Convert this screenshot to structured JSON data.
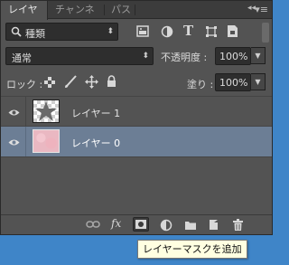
{
  "tabs": [
    {
      "label": "レイヤー",
      "active": true
    },
    {
      "label": "チャンネル",
      "active": false
    },
    {
      "label": "パス",
      "active": false
    }
  ],
  "tab_controls": {
    "collapse": "◂◂",
    "menu": "▾≡"
  },
  "filter": {
    "label": "種類",
    "icon": "search-icon"
  },
  "filter_icons": [
    "image-filter-icon",
    "adjustment-filter-icon",
    "type-filter-icon",
    "shape-filter-icon",
    "smart-object-filter-icon"
  ],
  "filter_type_glyph": "T",
  "blend_mode": "通常",
  "opacity": {
    "label": "不透明度 :",
    "value": "100%"
  },
  "lock": {
    "label": "ロック :",
    "icons": [
      "lock-transparent-icon",
      "lock-paint-icon",
      "lock-position-icon",
      "lock-all-icon"
    ]
  },
  "fill": {
    "label": "塗り :",
    "value": "100%"
  },
  "layers": [
    {
      "name": "レイヤー 1",
      "visible": true,
      "selected": false,
      "thumbnail": "star-on-transparent"
    },
    {
      "name": "レイヤー 0",
      "visible": true,
      "selected": true,
      "thumbnail": "pink-texture"
    }
  ],
  "bottom_icons": [
    "link-layers-icon",
    "fx-icon",
    "add-mask-icon",
    "adjustment-layer-icon",
    "folder-icon",
    "new-layer-icon",
    "trash-icon"
  ],
  "fx_label": "fx",
  "tooltip": "レイヤーマスクを追加",
  "colors": {
    "panel": "#535353",
    "selected_row": "#6c7e95",
    "desktop": "#3f85c8",
    "tooltip_bg": "#ffffe1"
  }
}
